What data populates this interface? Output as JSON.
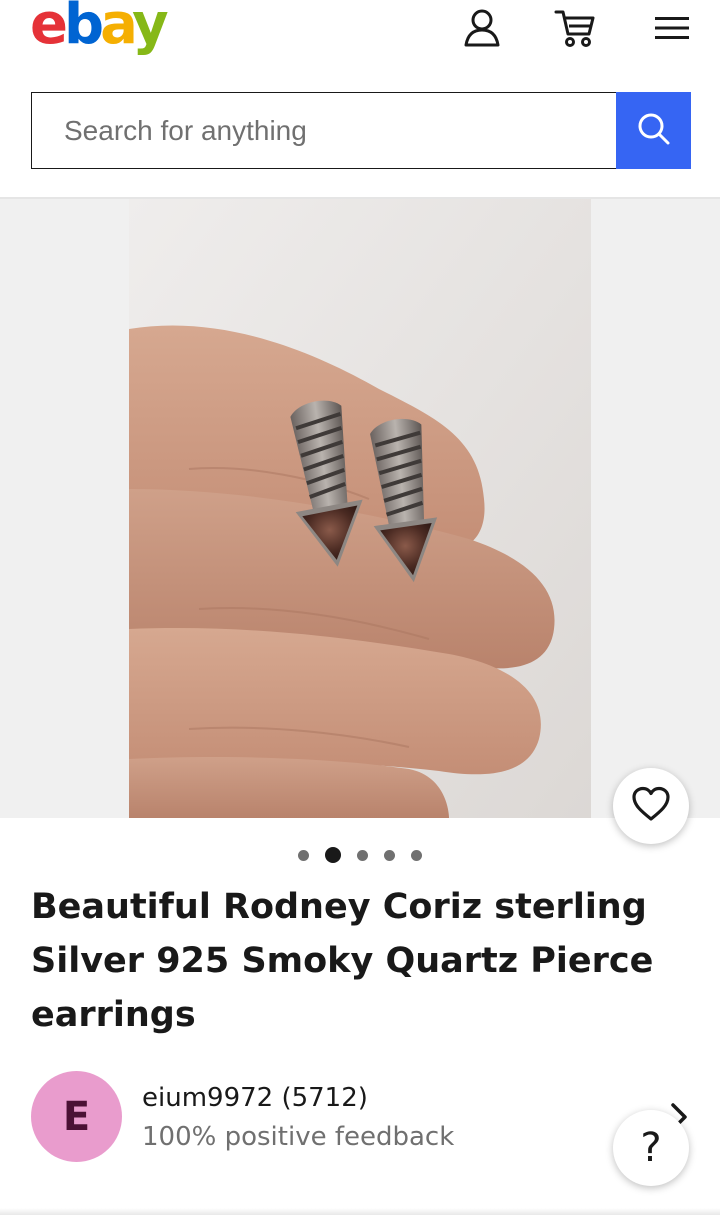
{
  "header": {
    "logo_letters": [
      "e",
      "b",
      "a",
      "y"
    ],
    "icons": {
      "account": "account-icon",
      "cart": "cart-icon",
      "menu": "hamburger-menu-icon"
    }
  },
  "search": {
    "placeholder": "Search for anything",
    "button_icon": "search-icon"
  },
  "gallery": {
    "image_count": 5,
    "active_index": 1,
    "favorite_icon": "heart-icon"
  },
  "listing": {
    "title": "Beautiful Rodney Coriz sterling Silver 925 Smoky Quartz Pierce earrings"
  },
  "seller": {
    "avatar_letter": "E",
    "name": "eium9972 (5712)",
    "feedback": "100% positive feedback"
  },
  "help": {
    "label": "?"
  },
  "colors": {
    "brand_red": "#e53238",
    "brand_blue": "#0064d2",
    "brand_yellow": "#f5af02",
    "brand_green": "#86b817",
    "search_button": "#3665f3",
    "avatar_bg": "#e99ccd"
  }
}
